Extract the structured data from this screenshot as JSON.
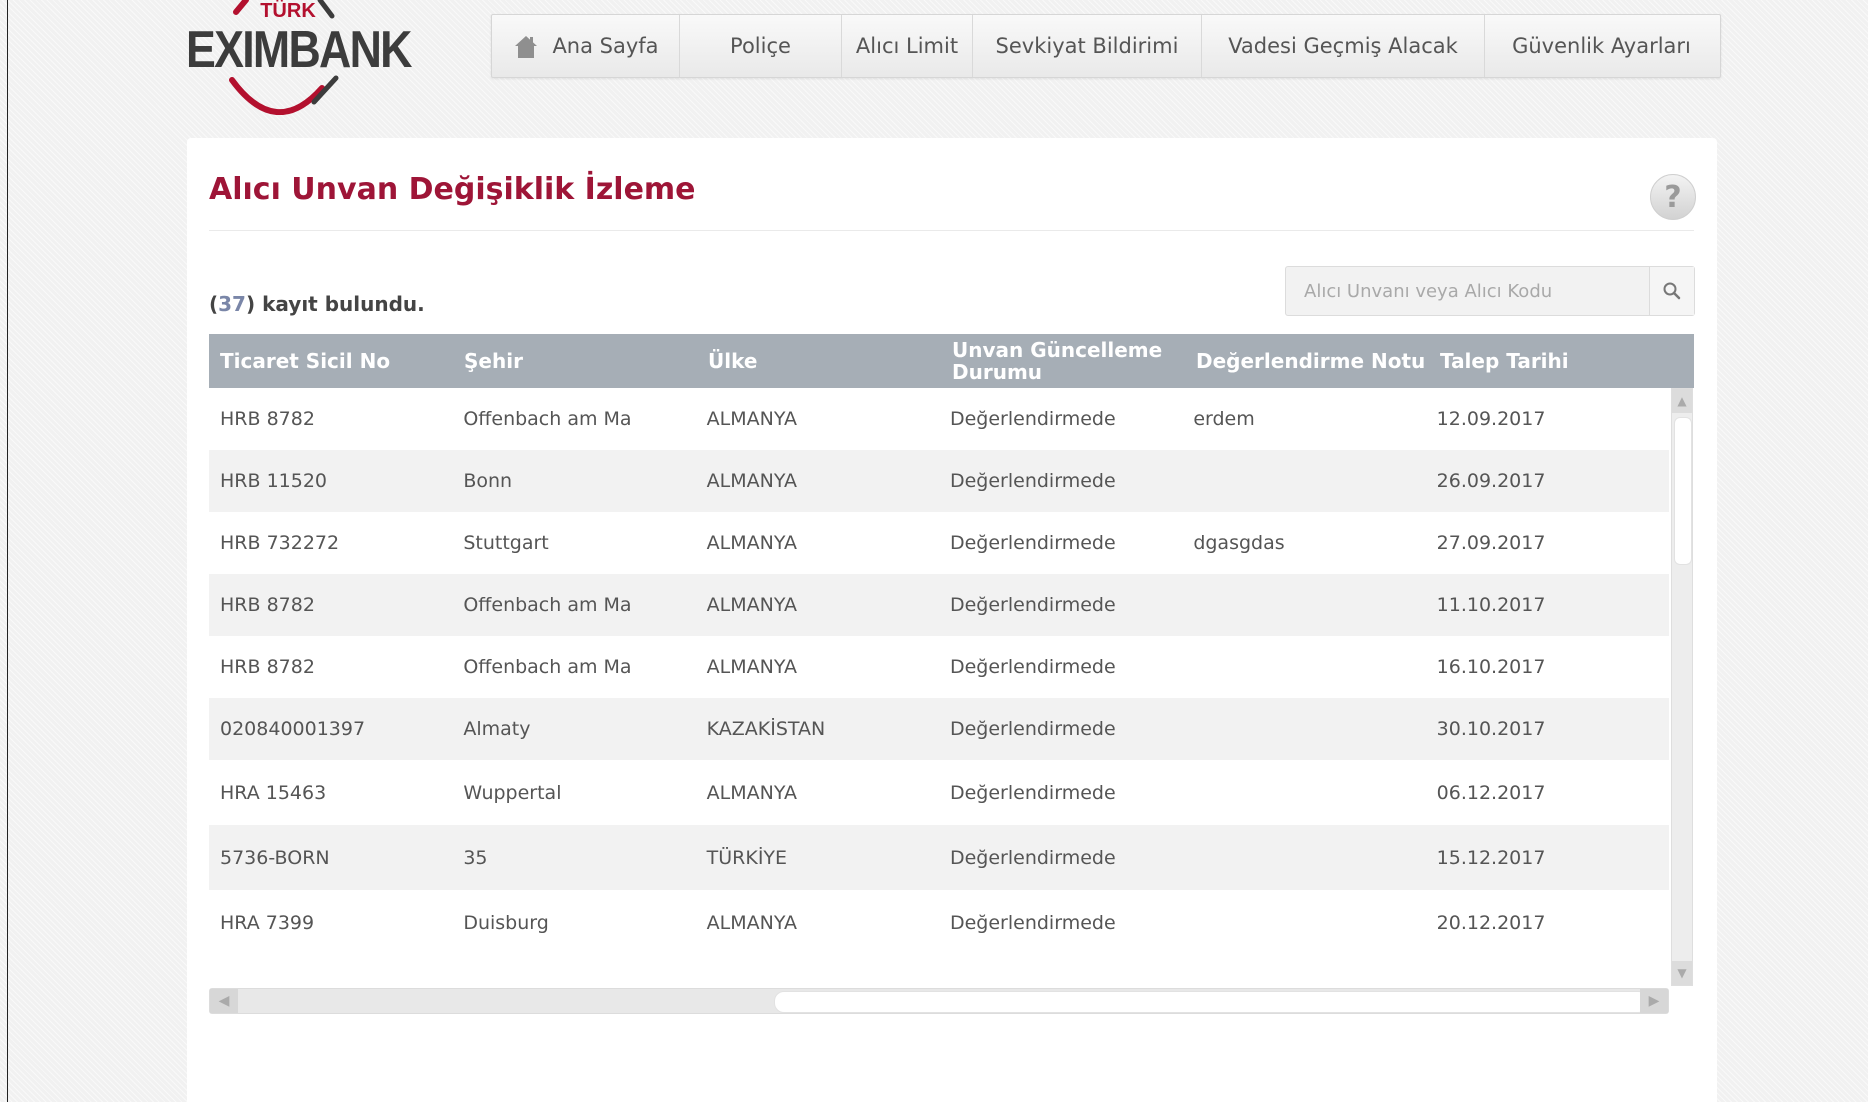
{
  "logo": {
    "top_text": "TÜRK",
    "word": "EXIMBANK"
  },
  "nav": [
    {
      "label": "Ana Sayfa",
      "icon": "home-icon"
    },
    {
      "label": "Poliçe"
    },
    {
      "label": "Alıcı Limit"
    },
    {
      "label": "Sevkiyat Bildirimi"
    },
    {
      "label": "Vadesi Geçmiş Alacak"
    },
    {
      "label": "Güvenlik Ayarları"
    }
  ],
  "page": {
    "title": "Alıcı Unvan Değişiklik İzleme",
    "help_icon": "?",
    "count": "37",
    "count_suffix": "kayıt bulundu."
  },
  "search": {
    "placeholder": "Alıcı Unvanı veya Alıcı Kodu",
    "icon": "search-icon"
  },
  "table": {
    "headers": [
      "Ticaret Sicil No",
      "Şehir",
      "Ülke",
      "Unvan Güncelleme Durumu",
      "Değerlendirme Notu",
      "Talep Tarihi"
    ],
    "rows": [
      [
        "HRB 8782",
        "Offenbach am Ma",
        "ALMANYA",
        "Değerlendirmede",
        "erdem",
        "12.09.2017"
      ],
      [
        "HRB 11520",
        "Bonn",
        "ALMANYA",
        "Değerlendirmede",
        "",
        "26.09.2017"
      ],
      [
        "HRB 732272",
        "Stuttgart",
        "ALMANYA",
        "Değerlendirmede",
        "dgasgdas",
        "27.09.2017"
      ],
      [
        "HRB 8782",
        "Offenbach am Ma",
        "ALMANYA",
        "Değerlendirmede",
        "",
        "11.10.2017"
      ],
      [
        "HRB 8782",
        "Offenbach am Ma",
        "ALMANYA",
        "Değerlendirmede",
        "",
        "16.10.2017"
      ],
      [
        "020840001397",
        "Almaty",
        "KAZAKİSTAN",
        "Değerlendirmede",
        "",
        "30.10.2017"
      ],
      [
        "HRA 15463",
        "Wuppertal",
        "ALMANYA",
        "Değerlendirmede",
        "",
        "06.12.2017"
      ],
      [
        "5736-BORN",
        "35",
        "TÜRKİYE",
        "Değerlendirmede",
        "",
        "15.12.2017"
      ],
      [
        "HRA 7399",
        "Duisburg",
        "ALMANYA",
        "Değerlendirmede",
        "",
        "20.12.2017"
      ]
    ]
  },
  "colors": {
    "accent": "#9e1537",
    "header_bg": "#a6aeb6",
    "logo_red": "#b3102e"
  }
}
